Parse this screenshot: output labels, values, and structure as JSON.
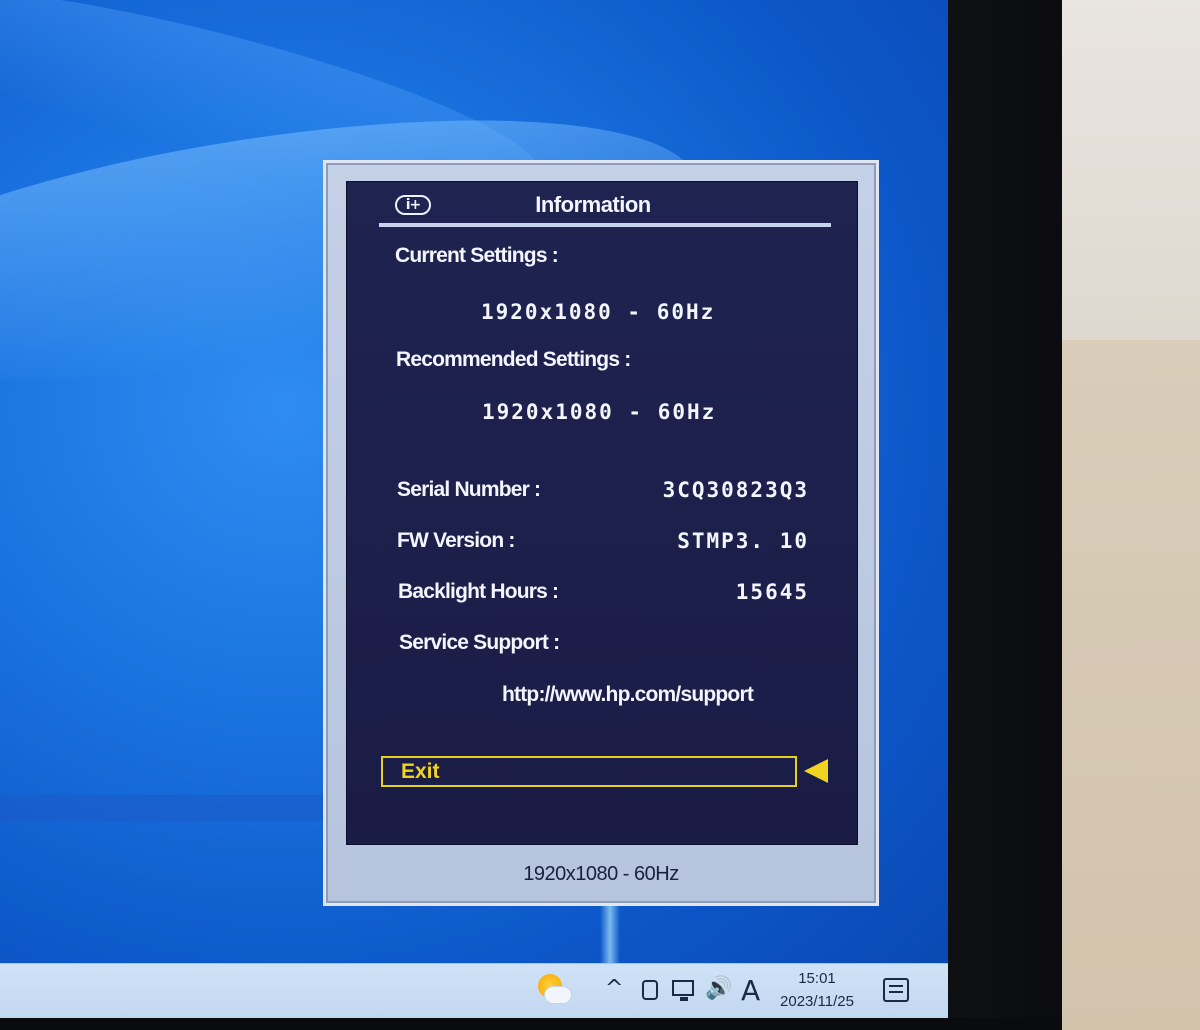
{
  "osd": {
    "title": "Information",
    "header_icon_text": "i+",
    "current_settings_label": "Current Settings :",
    "current_settings_value": "1920x1080 - 60Hz",
    "recommended_settings_label": "Recommended Settings :",
    "recommended_settings_value": "1920x1080 - 60Hz",
    "serial_number_label": "Serial Number :",
    "serial_number_value": "3CQ30823Q3",
    "fw_version_label": "FW Version :",
    "fw_version_value": "STMP3. 10",
    "backlight_hours_label": "Backlight Hours :",
    "backlight_hours_value": "15645",
    "service_support_label": "Service Support :",
    "service_support_url": "http://www.hp.com/support",
    "exit_label": "Exit",
    "footer_resolution": "1920x1080 - 60Hz",
    "colors": {
      "panel": "#1c1f4a",
      "frame": "#b6c4de",
      "highlight": "#f1d321",
      "text": "#f3f5ff"
    }
  },
  "taskbar": {
    "weather_icon": "sun-behind-cloud-icon",
    "tray_chevron": "^",
    "ime_indicator": "A",
    "time": "15:01",
    "date": "2023/11/25",
    "icons": [
      "chevron-up-icon",
      "meet-now-icon",
      "network-icon",
      "volume-icon",
      "notification-icon"
    ]
  }
}
